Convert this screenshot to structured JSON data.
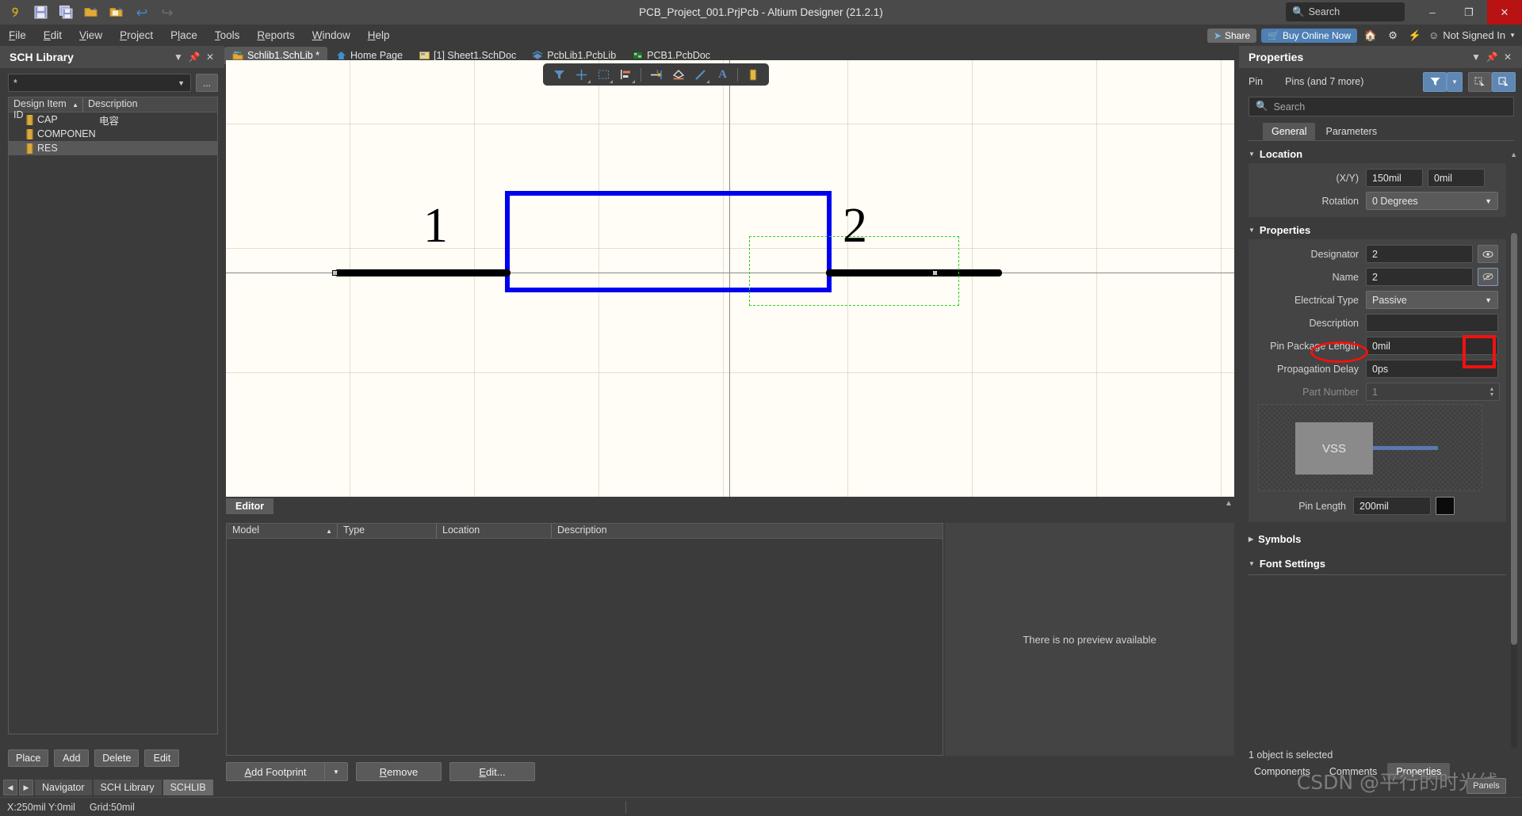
{
  "window": {
    "title": "PCB_Project_001.PrjPcb - Altium Designer (21.2.1)",
    "search_placeholder": "Search",
    "minimize": "–",
    "restore": "❐",
    "close": "✕"
  },
  "quick_access": [
    {
      "name": "altium-logo-icon",
      "glyph": "୨"
    },
    {
      "name": "save-icon",
      "glyph": "Ὃe"
    },
    {
      "name": "save-all-icon",
      "glyph": "὚b"
    },
    {
      "name": "open-icon",
      "glyph": "Ὄ2"
    },
    {
      "name": "open-project-icon",
      "glyph": "Ὄ1"
    },
    {
      "name": "undo-icon",
      "glyph": "↩"
    },
    {
      "name": "redo-icon",
      "glyph": "↪"
    }
  ],
  "menu": {
    "items": [
      "File",
      "Edit",
      "View",
      "Project",
      "Place",
      "Tools",
      "Reports",
      "Window",
      "Help"
    ],
    "share_label": "Share",
    "buy_label": "Buy Online Now",
    "signin_label": "Not Signed In",
    "right_icons": [
      "home-icon",
      "settings-icon",
      "notifications-icon"
    ]
  },
  "sch_library_panel": {
    "title": "SCH Library",
    "filter_value": "*",
    "dots_label": "...",
    "columns": [
      "Design Item ID",
      "Description"
    ],
    "items": [
      {
        "name": "CAP",
        "description": "电容",
        "selected": false
      },
      {
        "name": "COMPONEN",
        "description": "",
        "selected": false
      },
      {
        "name": "RES",
        "description": "",
        "selected": true
      }
    ],
    "buttons": [
      "Place",
      "Add",
      "Delete",
      "Edit"
    ]
  },
  "document_tabs": [
    {
      "label": "Schlib1.SchLib *",
      "icon": "schlib-icon",
      "active": true
    },
    {
      "label": "Home Page",
      "icon": "home-icon",
      "active": false
    },
    {
      "label": "[1] Sheet1.SchDoc",
      "icon": "schdoc-icon",
      "active": false
    },
    {
      "label": "PcbLib1.PcbLib",
      "icon": "pcblib-icon",
      "active": false
    },
    {
      "label": "PCB1.PcbDoc",
      "icon": "pcbdoc-icon",
      "active": false
    }
  ],
  "canvas_toolbar": [
    {
      "name": "filter-icon",
      "glyph": "▼"
    },
    {
      "name": "crosshair-icon",
      "glyph": "＋"
    },
    {
      "name": "select-area-icon",
      "glyph": "▢"
    },
    {
      "name": "align-icon",
      "glyph": "☰"
    },
    {
      "name": "place-pin-icon",
      "glyph": "⮔"
    },
    {
      "name": "place-polygon-icon",
      "glyph": "◇"
    },
    {
      "name": "place-line-icon",
      "glyph": "╱"
    },
    {
      "name": "place-text-icon",
      "glyph": "A"
    },
    {
      "name": "place-component-icon",
      "glyph": "▓"
    }
  ],
  "schematic": {
    "pin1_label": "1",
    "pin2_label": "2"
  },
  "editor": {
    "tab_label": "Editor",
    "columns": [
      "Model",
      "Type",
      "Location",
      "Description"
    ],
    "rows": [],
    "preview_text": "There is no preview available",
    "add_footprint_label": "Add Footprint",
    "remove_label": "Remove",
    "edit_label": "Edit..."
  },
  "left_bottom_tabs": [
    {
      "label": "Navigator",
      "active": false
    },
    {
      "label": "SCH Library",
      "active": false
    },
    {
      "label": "SCHLIB",
      "active": true
    }
  ],
  "status_bar": {
    "coords": "X:250mil Y:0mil",
    "grid": "Grid:50mil"
  },
  "properties_panel": {
    "title": "Properties",
    "object_type": "Pin",
    "object_scope": "Pins (and 7 more)",
    "search_placeholder": "Search",
    "tabs": [
      {
        "label": "General",
        "active": true
      },
      {
        "label": "Parameters",
        "active": false
      }
    ],
    "location": {
      "section_title": "Location",
      "xy_label": "(X/Y)",
      "x_value": "150mil",
      "y_value": "0mil",
      "rotation_label": "Rotation",
      "rotation_value": "0 Degrees"
    },
    "properties": {
      "section_title": "Properties",
      "designator_label": "Designator",
      "designator_value": "2",
      "name_label": "Name",
      "name_value": "2",
      "electrical_type_label": "Electrical Type",
      "electrical_type_value": "Passive",
      "description_label": "Description",
      "description_value": "",
      "pin_package_length_label": "Pin Package Length",
      "pin_package_length_value": "0mil",
      "propagation_delay_label": "Propagation Delay",
      "propagation_delay_value": "0ps",
      "part_number_label": "Part Number",
      "part_number_value": "1"
    },
    "preview": {
      "block_label": "VSS",
      "pin_length_label": "Pin Length",
      "pin_length_value": "200mil",
      "color_swatch": "#0b0b0b"
    },
    "symbols_section": "Symbols",
    "font_settings_section": "Font Settings",
    "status": "1 object is selected",
    "bottom_tabs": [
      {
        "label": "Components",
        "active": false
      },
      {
        "label": "Comments",
        "active": false
      },
      {
        "label": "Properties",
        "active": true
      }
    ],
    "panels_button": "Panels"
  },
  "annotations": {
    "highlight_color": "#f41010",
    "watermark": "CSDN @平行的时光线"
  }
}
